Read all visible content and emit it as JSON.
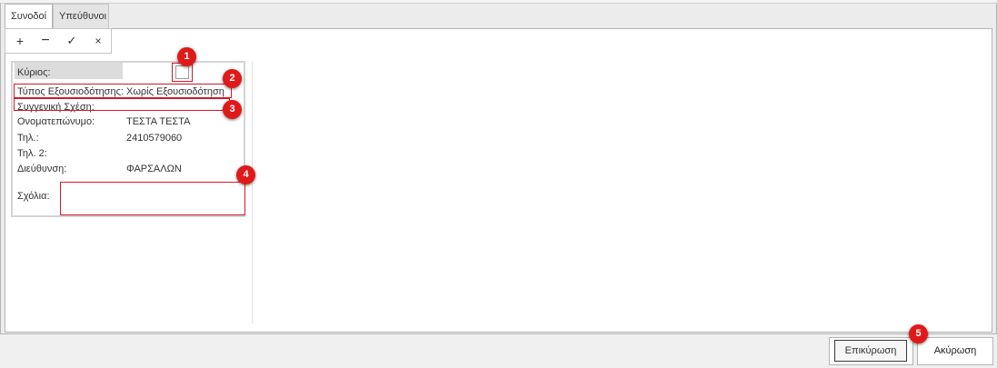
{
  "tabs": [
    {
      "label": "Συνοδοί"
    },
    {
      "label": "Υπεύθυνοι"
    }
  ],
  "toolbar": {
    "add_icon": "+",
    "remove_icon": "−",
    "confirm_icon": "✓",
    "cancel_icon": "×"
  },
  "form": {
    "primary_label": "Κύριος:",
    "primary_checked": false,
    "authorization_label": "Τύπος Εξουσιοδότησης:",
    "authorization_value": "Χωρίς Εξουσιοδότηση",
    "relation_label": "Συγγενική Σχέση:",
    "relation_value": "",
    "fullname_label": "Ονοματεπώνυμο:",
    "fullname_value": "ΤΕΣΤΑ ΤΕΣΤΑ",
    "phone_label": "Τηλ.:",
    "phone_value": "2410579060",
    "phone2_label": "Τηλ. 2:",
    "phone2_value": "",
    "address_label": "Διεύθυνση:",
    "address_value": "ΦΑΡΣΑΛΩΝ",
    "comments_label": "Σχόλια:",
    "comments_value": ""
  },
  "badges": [
    "1",
    "2",
    "3",
    "4",
    "5"
  ],
  "buttons": {
    "confirm": "Επικύρωση",
    "cancel": "Ακύρωση"
  },
  "colors": {
    "highlight": "#d11a2a",
    "badge": "#e01919"
  }
}
